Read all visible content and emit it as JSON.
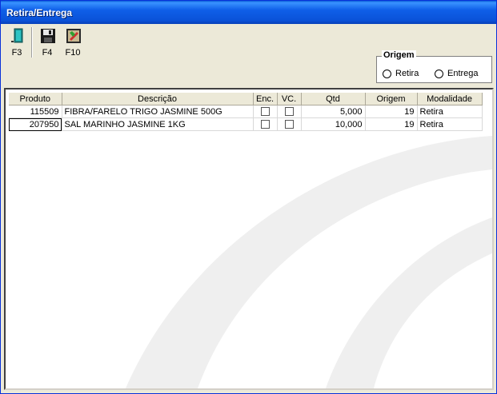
{
  "window": {
    "title": "Retira/Entrega"
  },
  "toolbar": {
    "buttons": [
      {
        "key": "F3",
        "icon": "exit-door-icon"
      },
      {
        "key": "F4",
        "icon": "save-disk-icon"
      },
      {
        "key": "F10",
        "icon": "settings-icon"
      }
    ]
  },
  "origem": {
    "title": "Origem",
    "options": [
      {
        "label": "Retira",
        "selected": false
      },
      {
        "label": "Entrega",
        "selected": false
      }
    ]
  },
  "grid": {
    "columns": [
      "Produto",
      "Descrição",
      "Enc.",
      "VC.",
      "Qtd",
      "Origem",
      "Modalidade"
    ],
    "rows": [
      {
        "produto": "115509",
        "descricao": "FIBRA/FARELO TRIGO JASMINE 500G",
        "enc": false,
        "vc": false,
        "qtd": "5,000",
        "origem": "19",
        "modalidade": "Retira"
      },
      {
        "produto": "207950",
        "descricao": "SAL MARINHO JASMINE 1KG",
        "enc": false,
        "vc": false,
        "qtd": "10,000",
        "origem": "19",
        "modalidade": "Retira"
      }
    ]
  }
}
